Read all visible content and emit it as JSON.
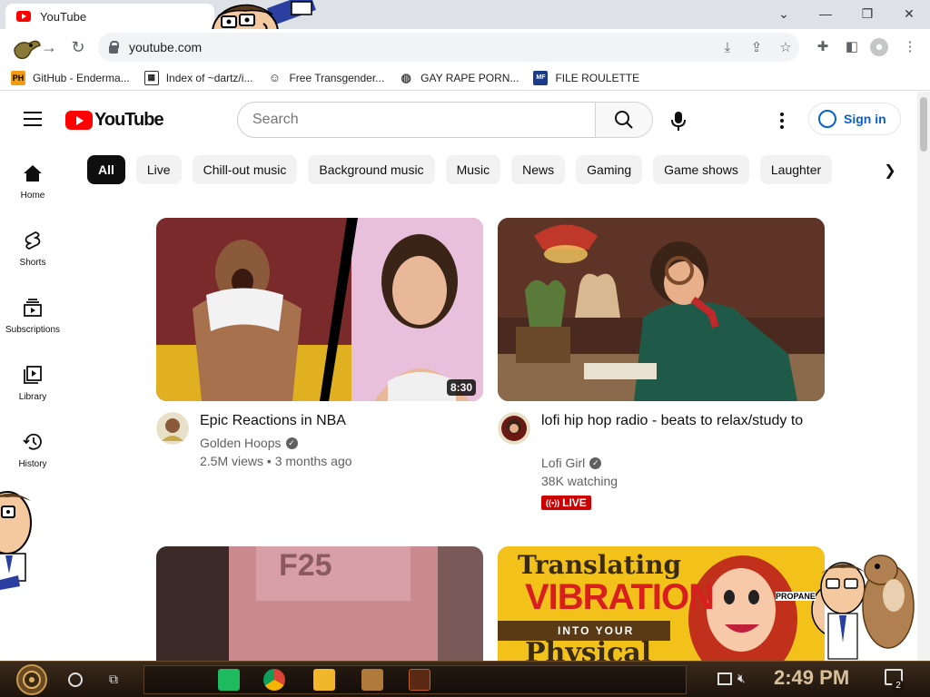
{
  "browser": {
    "tab_title": "YouTube",
    "url": "youtube.com",
    "bookmarks": [
      {
        "label": "GitHub - Enderma...",
        "icon": "ph-icon"
      },
      {
        "label": "Index of ~dartz/i...",
        "icon": "box-icon"
      },
      {
        "label": "Free Transgender...",
        "icon": "mask-icon"
      },
      {
        "label": "GAY RAPE PORN...",
        "icon": "globe-icon"
      },
      {
        "label": "FILE ROULETTE",
        "icon": "mf-icon"
      }
    ]
  },
  "youtube": {
    "logo_text": "YouTube",
    "search_placeholder": "Search",
    "signin_label": "Sign in",
    "chips": [
      "All",
      "Live",
      "Chill-out music",
      "Background music",
      "Music",
      "News",
      "Gaming",
      "Game shows",
      "Laughter"
    ],
    "sidebar": [
      {
        "label": "Home",
        "icon": "home-icon"
      },
      {
        "label": "Shorts",
        "icon": "shorts-icon"
      },
      {
        "label": "Subscriptions",
        "icon": "subscriptions-icon"
      },
      {
        "label": "Library",
        "icon": "library-icon"
      },
      {
        "label": "History",
        "icon": "history-icon"
      }
    ],
    "videos": [
      {
        "title": "Epic Reactions in NBA",
        "channel": "Golden Hoops",
        "meta": "2.5M views • 3 months ago",
        "duration": "8:30"
      },
      {
        "title": "lofi hip hop radio - beats to relax/study to",
        "channel": "Lofi Girl",
        "meta": "38K watching",
        "badge": "LIVE"
      },
      {
        "thumb_text": "F25"
      },
      {
        "thumb_text_1": "Translating",
        "thumb_text_2": "VIBRATION",
        "thumb_text_3": "INTO YOUR",
        "thumb_text_4": "Physical",
        "thumb_text_5": "PROPANE"
      }
    ]
  },
  "taskbar": {
    "time": "2:49 PM",
    "notification_count": "2"
  },
  "colors": {
    "accent": "#ff0000",
    "link": "#065fd4",
    "live": "#cc0000"
  }
}
